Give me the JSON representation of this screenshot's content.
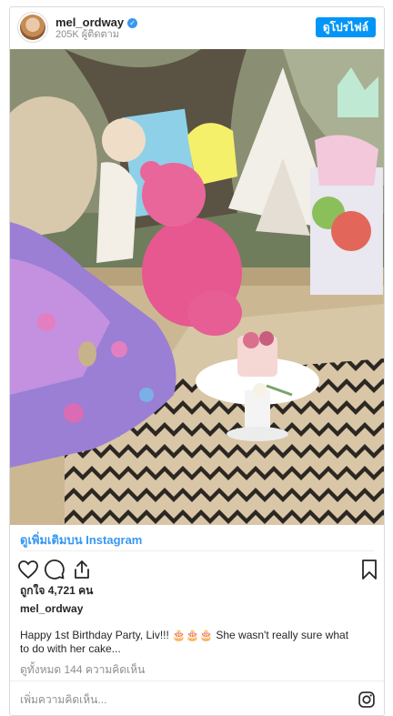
{
  "header": {
    "username": "mel_ordway",
    "verified_icon": "check-icon",
    "followers": "205K ผู้ติดตาม",
    "profile_button": "ดูโปรไฟล์"
  },
  "link": {
    "view_more": "ดูเพิ่มเติมบน Instagram"
  },
  "icons": {
    "like": "heart-icon",
    "comment": "comment-icon",
    "share": "share-icon",
    "save": "bookmark-icon",
    "instagram": "instagram-icon"
  },
  "post": {
    "likes": "ถูกใจ 4,721 คน",
    "username": "mel_ordway",
    "caption": "Happy 1st Birthday Party, Liv!!! 🎂🎂🎂 She wasn't really sure what to do with her cake...",
    "view_comments": "ดูทั้งหมด 144 ความคิดเห็น"
  },
  "comment": {
    "placeholder": "เพิ่มความคิดเห็น..."
  },
  "colors": {
    "accent": "#3897f0",
    "button": "#0095f6",
    "muted": "#8e8e8e",
    "border": "#dbdbdb"
  }
}
